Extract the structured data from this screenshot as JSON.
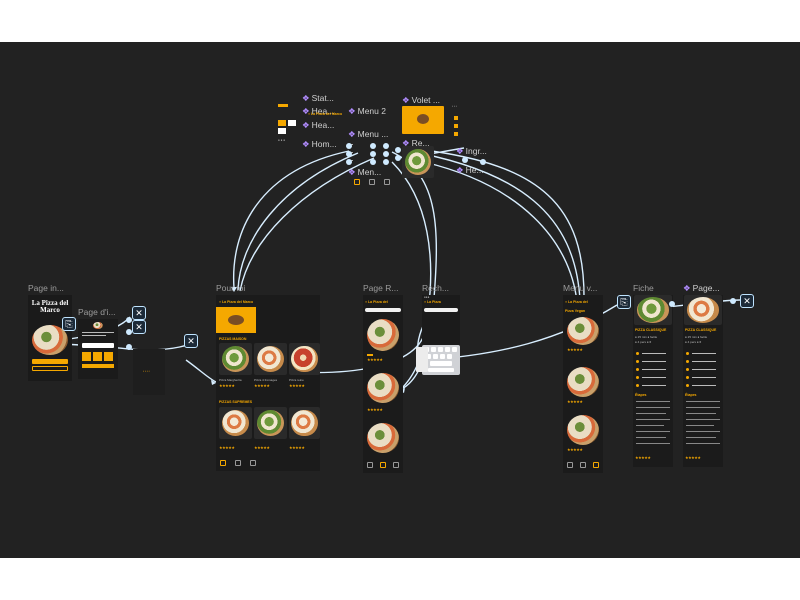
{
  "canvas": {
    "background": "#222222",
    "accent": "#f5a800",
    "connector_color": "#cfeaff"
  },
  "frames": {
    "page_in": "Page in...",
    "page_di": "Page d'i...",
    "pour_toi": "Pour toi",
    "page_r": "Page R...",
    "rech": "Rech...",
    "menu_v": "Menu v...",
    "fiche": "Fiche",
    "page2": "Page..."
  },
  "components": {
    "stat": "Stat...",
    "hea1": "Hea...",
    "hea2": "Hea...",
    "hom": "Hom...",
    "menu2": "Menu 2",
    "menu_dots": "Menu ...",
    "men": "Men...",
    "volet": "Volet ...",
    "re": "Re...",
    "ingr": "Ingr...",
    "he": "He..."
  },
  "splash": {
    "title_line1": "La Pizza del",
    "title_line2": "Marco"
  },
  "icons": {
    "copy": "copy-frame-icon",
    "close": "close-overlay-icon",
    "component": "component-diamond-icon"
  }
}
